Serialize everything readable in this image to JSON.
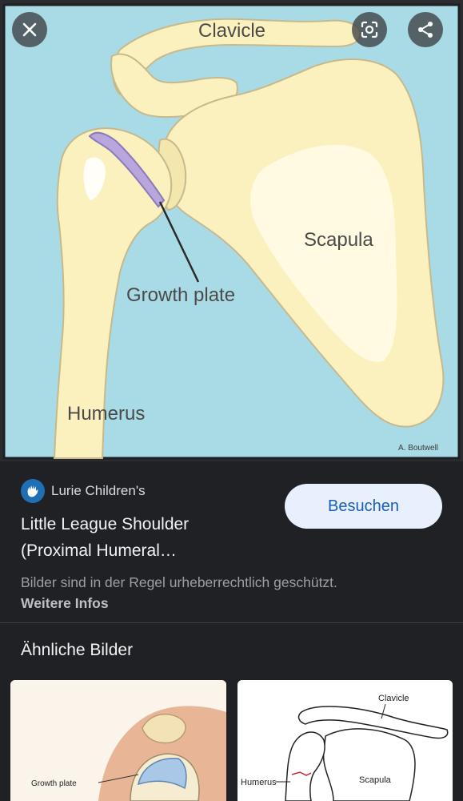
{
  "viewer": {
    "image_labels": {
      "clavicle": "Clavicle",
      "scapula": "Scapula",
      "growth_plate": "Growth plate",
      "humerus": "Humerus",
      "credit": "A. Boutwell"
    },
    "icons": [
      "close-icon",
      "lens-icon",
      "share-icon"
    ],
    "colors": {
      "water": "#a9dbe6",
      "bone": "#fbf1bf",
      "growth_plate": "#b9a6dc"
    }
  },
  "result": {
    "source_name": "Lurie Children's",
    "title_line1": "Little League Shoulder",
    "title_line2": "(Proximal Humeral…",
    "visit_label": "Besuchen",
    "copyright_text": "Bilder sind in der Regel urheberrechtlich geschützt.",
    "more_info_label": "Weitere Infos"
  },
  "similar": {
    "heading": "Ähnliche Bilder",
    "thumbs": [
      {
        "labels": {
          "growth_plate": "Growth plate"
        }
      },
      {
        "labels": {
          "clavicle": "Clavicle",
          "humerus": "Humerus",
          "scapula": "Scapula"
        }
      }
    ]
  }
}
